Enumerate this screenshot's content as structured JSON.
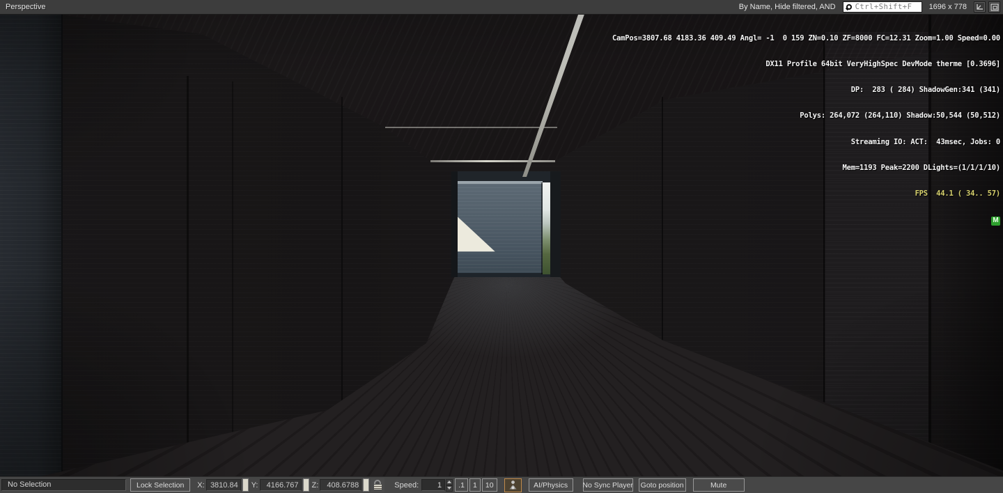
{
  "topbar": {
    "view_label": "Perspective",
    "filter_label": "By Name, Hide filtered, AND",
    "search_placeholder": "Ctrl+Shift+F",
    "resolution": "1696 x 778"
  },
  "debug": {
    "lines": [
      "CamPos=3807.68 4183.36 409.49 Angl= -1  0 159 ZN=0.10 ZF=8000 FC=12.31 Zoom=1.00 Speed=0.00",
      "DX11 Profile 64bit VeryHighSpec DevMode therme [0.3696]",
      "DP:  283 ( 284) ShadowGen:341 (341)",
      "Polys: 264,072 (264,110) Shadow:50,544 (50,512)",
      "Streaming IO: ACT:  43msec, Jobs: 0",
      "Mem=1193 Peak=2200 DLights=(1/1/1/10)"
    ],
    "fps": "FPS  44.1 ( 34.. 57)",
    "badge": "M"
  },
  "statusbar": {
    "selection": "No Selection",
    "lock_selection_label": "Lock Selection",
    "x_label": "X:",
    "x_value": "3810.84",
    "y_label": "Y:",
    "y_value": "4166.767",
    "z_label": "Z:",
    "z_value": "408.6788",
    "speed_label": "Speed:",
    "speed_value": "1",
    "speed_presets": [
      ".1",
      "1",
      "10"
    ],
    "buttons": {
      "ai_physics": "AI/Physics",
      "no_sync_player": "No Sync Player",
      "goto_position": "Goto position",
      "mute": "Mute"
    }
  },
  "icons": {
    "search": "magnifier-glass",
    "axis_gizmo": "camera-axis-corner",
    "layout": "maximize-panel",
    "coordinate_lock": "padlock",
    "simulate": "person-figure"
  },
  "colors": {
    "topbar_bg": "#3d3d3d",
    "statusbar_bg": "#464646",
    "fps_text": "#d6d06d",
    "monitor_badge": "#2ea02e",
    "simulate_border": "#c08a4a",
    "doorway_wall": "#505d68",
    "sunlight_patch": "#eceadd"
  }
}
